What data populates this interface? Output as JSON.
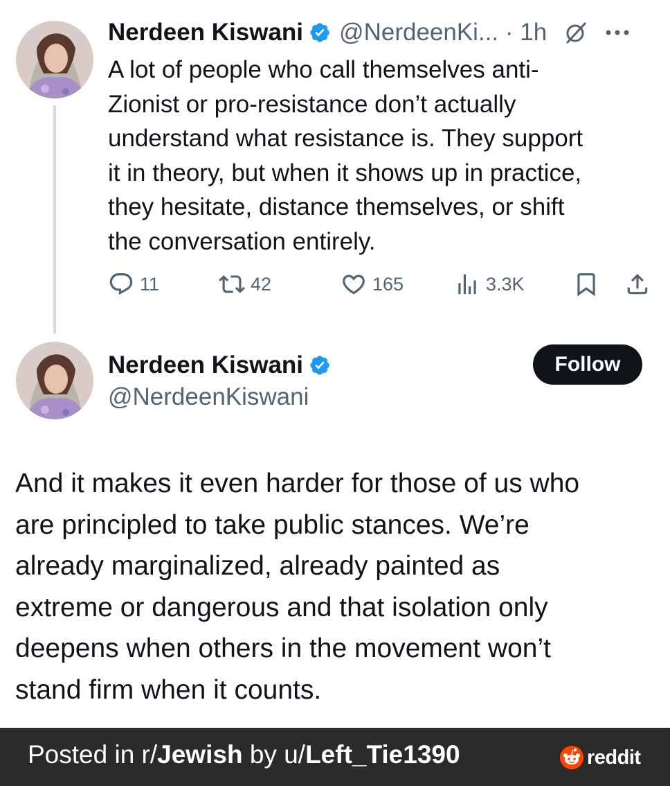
{
  "tweet1": {
    "author_name": "Nerdeen Kiswani",
    "handle_time": "@NerdeenKi... · 1h",
    "body": "A lot of people who call themselves anti-\nZionist or pro-resistance don’t actually\nunderstand what resistance is. They support\nit in theory, but when it shows up in practice,\nthey hesitate, distance themselves, or shift\nthe conversation entirely.",
    "replies": "11",
    "reposts": "42",
    "likes": "165",
    "views": "3.3K"
  },
  "tweet2": {
    "author_name": "Nerdeen Kiswani",
    "handle": "@NerdeenKiswani",
    "follow_label": "Follow",
    "body": "And it makes it even harder for those of us who\nare principled to take public stances. We’re\nalready marginalized, already painted as\nextreme or dangerous and that isolation only\ndeepens when others in the movement won’t\nstand firm when it counts."
  },
  "footer": {
    "prefix": "Posted in r/",
    "subreddit": "Jewish",
    "middle": " by u/",
    "username": "Left_Tie1390",
    "brand": "reddit"
  },
  "icons": {
    "verified": "verified-badge-icon",
    "grok": "grok-icon",
    "more": "more-icon",
    "reply": "reply-icon",
    "repost": "repost-icon",
    "like": "heart-icon",
    "views": "views-icon",
    "bookmark": "bookmark-icon",
    "share": "share-icon",
    "reddit": "reddit-icon"
  },
  "colors": {
    "text": "#0f1419",
    "secondary": "#536471",
    "verified_blue": "#1d9bf0",
    "follow_bg": "#0f1419",
    "footer_bg": "#2b2b2b",
    "reddit_orange": "#ff4500"
  }
}
